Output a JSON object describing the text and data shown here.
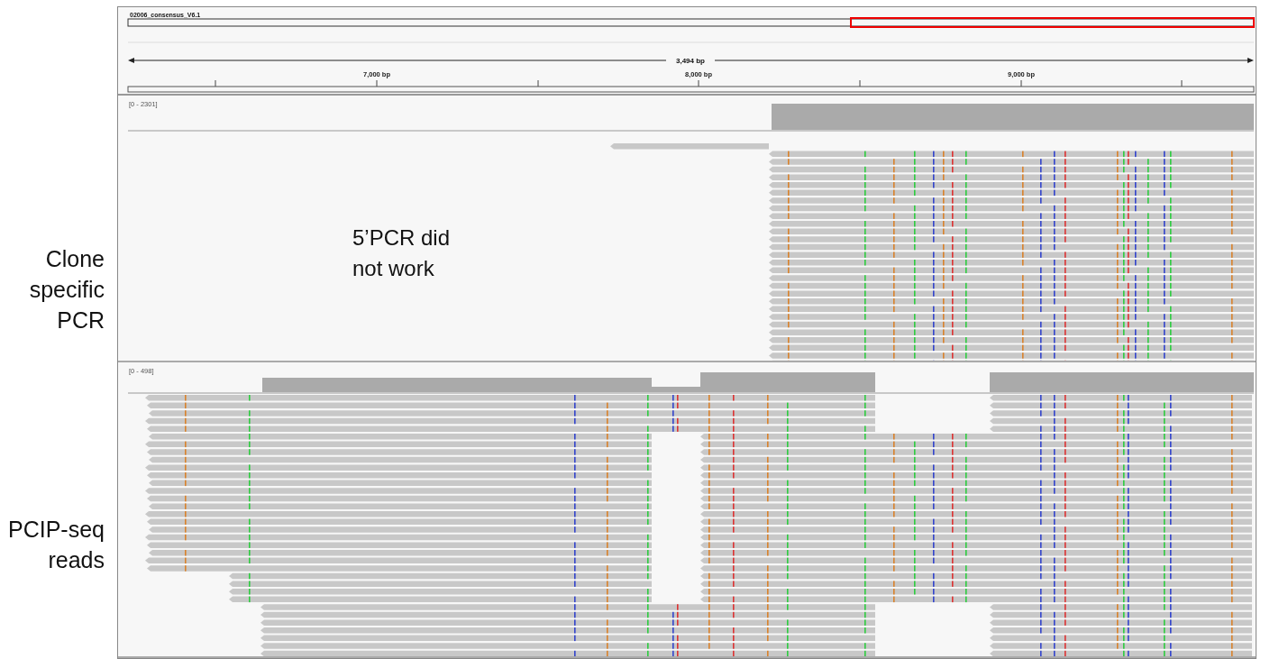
{
  "side_labels": [
    {
      "text": "Clone specific PCR"
    },
    {
      "text": "PCIP-seq reads"
    }
  ],
  "igv": {
    "sequence_name": "02006_consensus_V6.1",
    "span": "3,494 bp",
    "ticks": [
      {
        "label": "7,000 bp"
      },
      {
        "label": "8,000 bp"
      },
      {
        "label": "9,000 bp"
      }
    ],
    "tracks": [
      {
        "kind": "clone",
        "data_range": "[0 - 2301]",
        "annotation": "5’PCR did not work"
      },
      {
        "kind": "pcip",
        "data_range": "[0 - 498]"
      }
    ]
  }
}
